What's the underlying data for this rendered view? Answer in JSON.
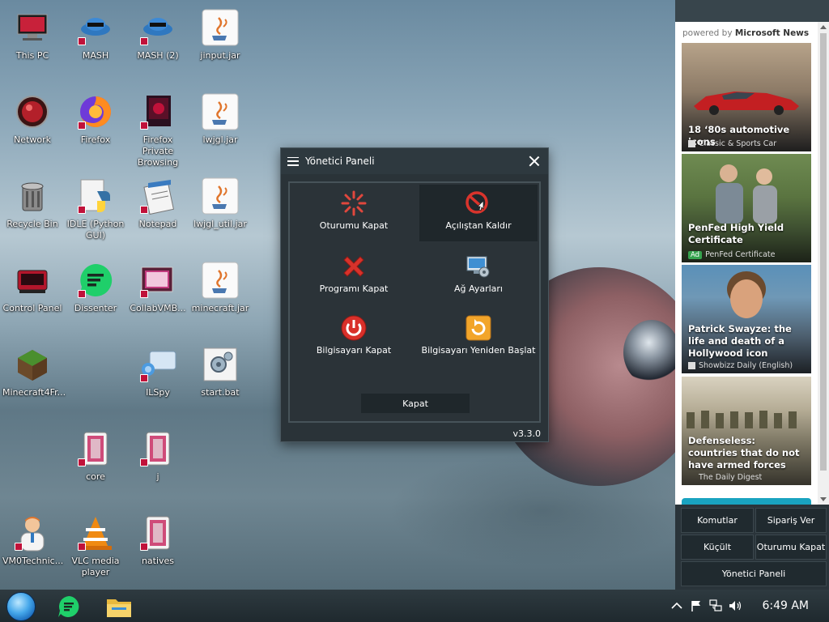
{
  "desktop": {
    "icons": [
      {
        "label": "This PC",
        "icon": "computer-icon"
      },
      {
        "label": "MASH",
        "icon": "mash-icon"
      },
      {
        "label": "MASH (2)",
        "icon": "mash-icon"
      },
      {
        "label": "jinput.jar",
        "icon": "java-icon"
      },
      {
        "label": "Network",
        "icon": "network-icon"
      },
      {
        "label": "Firefox",
        "icon": "firefox-icon"
      },
      {
        "label": "Firefox Private Browsing",
        "icon": "firefox-private-icon"
      },
      {
        "label": "lwjgl.jar",
        "icon": "java-icon"
      },
      {
        "label": "Recycle Bin",
        "icon": "recycle-bin-icon"
      },
      {
        "label": "IDLE (Python GUI)",
        "icon": "python-icon"
      },
      {
        "label": "Notepad",
        "icon": "notepad-icon"
      },
      {
        "label": "lwjgl_util.jar",
        "icon": "java-icon"
      },
      {
        "label": "Control Panel",
        "icon": "control-panel-icon"
      },
      {
        "label": "Dissenter",
        "icon": "dissenter-icon"
      },
      {
        "label": "CollabVMB...",
        "icon": "collabvm-icon"
      },
      {
        "label": "minecraft.jar",
        "icon": "java-icon"
      },
      {
        "label": "Minecraft4Fr...",
        "icon": "minecraft-icon"
      },
      {
        "label": "ILSpy",
        "icon": "ilspy-icon"
      },
      {
        "label": "start.bat",
        "icon": "batch-file-icon"
      },
      {
        "label": "core",
        "icon": "archive-icon"
      },
      {
        "label": "j",
        "icon": "archive-icon"
      },
      {
        "label": "VM0Technic...",
        "icon": "technician-icon"
      },
      {
        "label": "VLC media player",
        "icon": "vlc-icon"
      },
      {
        "label": "natives",
        "icon": "archive-icon"
      }
    ]
  },
  "dialog": {
    "title": "Yönetici Paneli",
    "buttons": [
      {
        "label": "Oturumu Kapat",
        "icon": "logoff-icon"
      },
      {
        "label": "Açılıştan Kaldır",
        "icon": "remove-startup-icon"
      },
      {
        "label": "Programı Kapat",
        "icon": "red-x-icon"
      },
      {
        "label": "Ağ Ayarları",
        "icon": "network-settings-icon"
      },
      {
        "label": "Bilgisayarı Kapat",
        "icon": "power-icon"
      },
      {
        "label": "Bilgisayarı Yeniden Başlat",
        "icon": "restart-icon"
      }
    ],
    "close_label": "Kapat",
    "version": "v3.3.0"
  },
  "news": {
    "powered_prefix": "powered by ",
    "powered_brand": "Microsoft News",
    "cards": [
      {
        "headline": "18 ‘80s automotive icons",
        "source": "Classic & Sports Car",
        "ad": false
      },
      {
        "headline": "PenFed High Yield Certificate",
        "source": "PenFed Certificate",
        "ad": true,
        "ad_label": "Ad"
      },
      {
        "headline": "Patrick Swayze: the life and death of a Hollywood icon",
        "source": "Showbizz Daily (English)",
        "ad": false
      },
      {
        "headline": "Defenseless: countries that do not have armed forces",
        "source": "The Daily Digest",
        "ad": false
      }
    ]
  },
  "panel_buttons": {
    "komutlar": "Komutlar",
    "siparis_ver": "Sipariş Ver",
    "kucult": "Küçült",
    "oturumu_kapat": "Oturumu Kapat",
    "yonetici_paneli": "Yönetici Paneli"
  },
  "taskbar": {
    "apps": [
      "start-orb-icon",
      "dissenter-icon",
      "file-explorer-icon"
    ],
    "tray_icons": [
      "chevron-up-icon",
      "flag-icon",
      "network-icon",
      "volume-icon"
    ],
    "clock": "6:49 AM"
  },
  "colors": {
    "dialog_bg": "#2a3338",
    "panel_bg": "#2a343a",
    "accent": "#19a3c0"
  }
}
